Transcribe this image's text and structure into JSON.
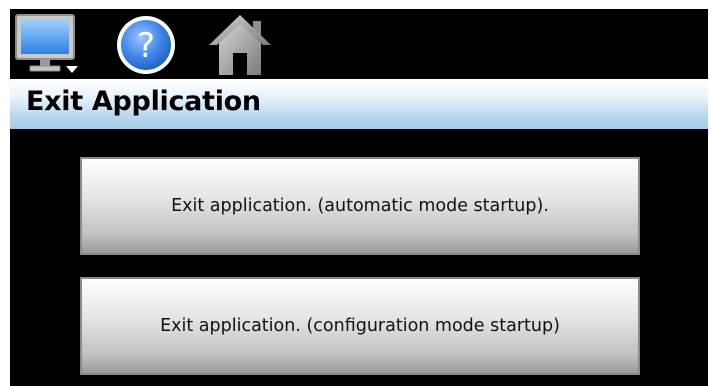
{
  "toolbar": {
    "icons": [
      {
        "name": "monitor-icon"
      },
      {
        "name": "help-icon",
        "glyph": "?"
      },
      {
        "name": "home-icon"
      }
    ]
  },
  "title": "Exit Application",
  "buttons": [
    {
      "label": "Exit application. (automatic mode startup)."
    },
    {
      "label": "Exit application. (configuration mode startup)"
    }
  ],
  "colors": {
    "screen_background": "#000000",
    "title_bar_gradient": [
      "#ffffff",
      "#a6cbe8"
    ],
    "button_gradient": [
      "#ffffff",
      "#9a9a9a"
    ],
    "help_icon_blue": "#2c6fd1",
    "home_icon_gray": "#8e8e8e"
  }
}
